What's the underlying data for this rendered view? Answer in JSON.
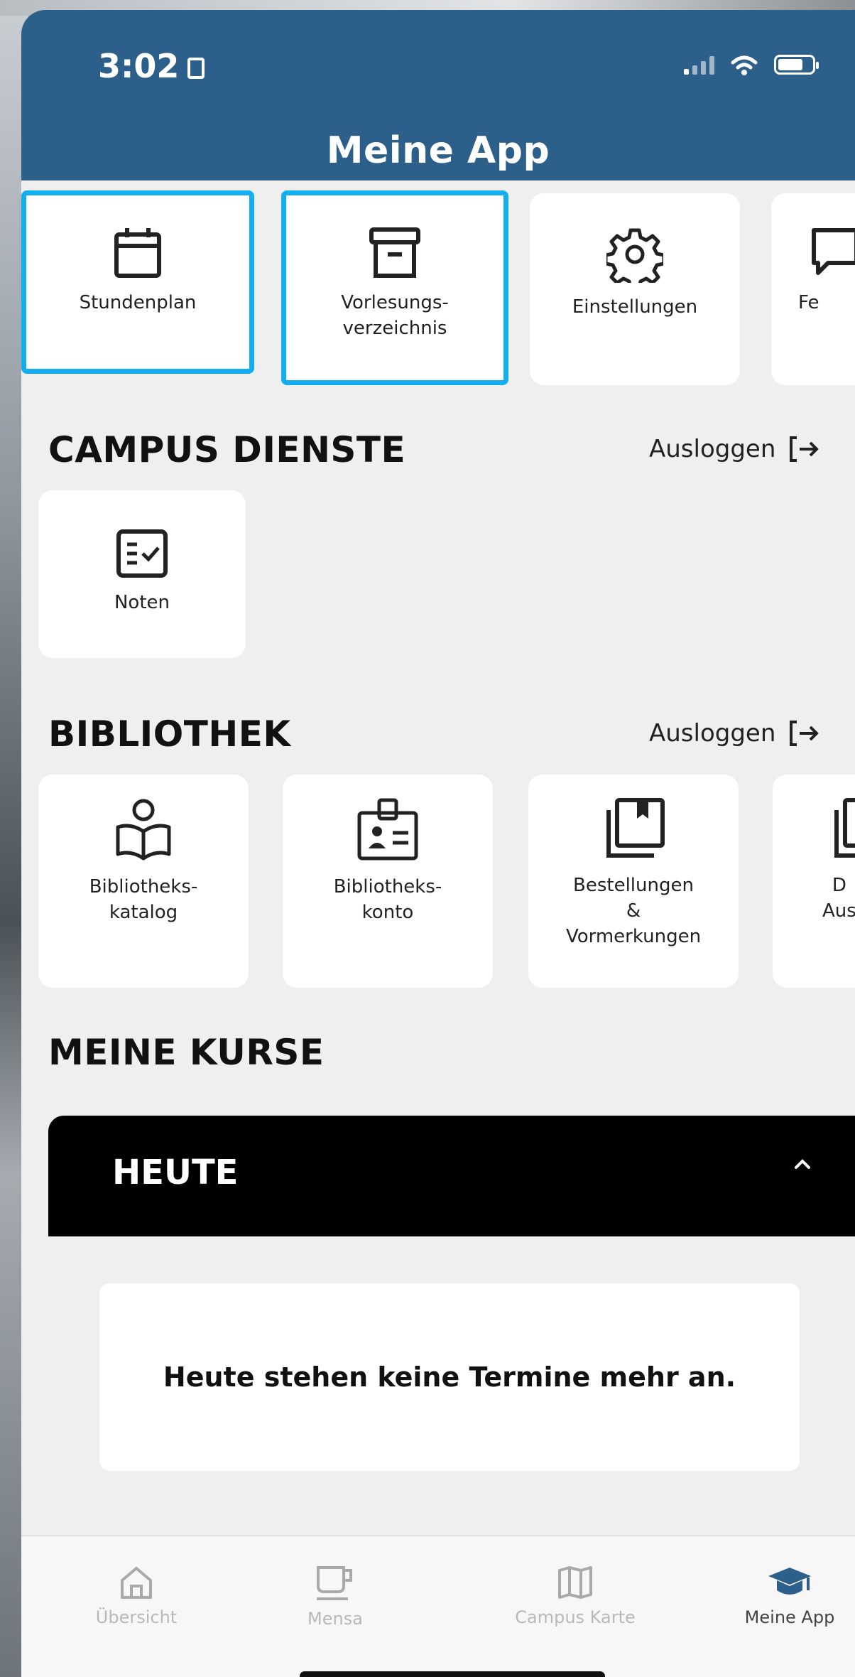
{
  "status_bar": {
    "time": "3:02"
  },
  "header": {
    "title": "Meine App"
  },
  "quick_tiles": [
    {
      "label": "Stundenplan",
      "icon": "calendar-icon"
    },
    {
      "label": "Vorlesungs-\nverzeichnis",
      "icon": "archive-box-icon"
    },
    {
      "label": "Einstellungen",
      "icon": "gear-icon"
    },
    {
      "label": "Fe",
      "icon": "feedback-icon"
    }
  ],
  "campus": {
    "title": "CAMPUS DIENSTE",
    "logout": "Ausloggen",
    "tiles": [
      {
        "label": "Noten",
        "icon": "grades-checklist-icon"
      }
    ]
  },
  "library": {
    "title": "BIBLIOTHEK",
    "logout": "Ausloggen",
    "tiles": [
      {
        "label": "Bibliotheks-\nkatalog",
        "icon": "reading-person-icon"
      },
      {
        "label": "Bibliotheks-\nkonto",
        "icon": "id-badge-icon"
      },
      {
        "label": "Bestellungen\n&\nVormerkungen",
        "icon": "bookmark-stack-icon"
      },
      {
        "label": "D\nAus",
        "icon": "bookmark-stack-icon"
      }
    ]
  },
  "courses": {
    "title": "MEINE KURSE",
    "today_label": "HEUTE",
    "empty_message": "Heute stehen keine Termine mehr an."
  },
  "tabbar": {
    "items": [
      {
        "label": "Übersicht",
        "icon": "home-icon",
        "active": false
      },
      {
        "label": "Mensa",
        "icon": "cup-icon",
        "active": false
      },
      {
        "label": "Campus Karte",
        "icon": "map-icon",
        "active": false
      },
      {
        "label": "Meine App",
        "icon": "graduation-cap-icon",
        "active": true
      }
    ]
  },
  "colors": {
    "header": "#2d5f8b",
    "highlight": "#12aef0",
    "background": "#efefef"
  }
}
